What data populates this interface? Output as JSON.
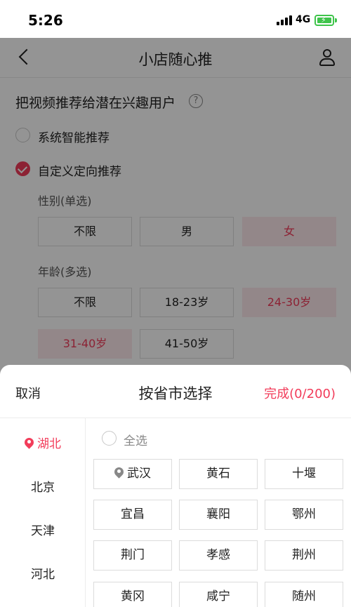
{
  "status_bar": {
    "time": "5:26",
    "network": "4G",
    "signal_icon": "signal-bars-icon",
    "battery_icon": "battery-charging-icon"
  },
  "nav": {
    "title": "小店随心推",
    "back_icon": "back-arrow-icon",
    "user_icon": "user-icon"
  },
  "main": {
    "section_title": "把视频推荐给潜在兴趣用户",
    "help_icon_glyph": "?",
    "options": [
      {
        "label": "系统智能推荐",
        "checked": false
      },
      {
        "label": "自定义定向推荐",
        "checked": true
      }
    ],
    "gender": {
      "label": "性别(单选)",
      "choices": [
        {
          "label": "不限",
          "selected": false
        },
        {
          "label": "男",
          "selected": false
        },
        {
          "label": "女",
          "selected": true
        }
      ]
    },
    "age": {
      "label": "年龄(多选)",
      "choices": [
        {
          "label": "不限",
          "selected": false
        },
        {
          "label": "18-23岁",
          "selected": false
        },
        {
          "label": "24-30岁",
          "selected": true
        },
        {
          "label": "31-40岁",
          "selected": true
        },
        {
          "label": "41-50岁",
          "selected": false
        }
      ]
    }
  },
  "sheet": {
    "cancel_label": "取消",
    "title": "按省市选择",
    "done_label": "完成(0/200)",
    "provinces": [
      {
        "label": "湖北",
        "active": true
      },
      {
        "label": "北京",
        "active": false
      },
      {
        "label": "天津",
        "active": false
      },
      {
        "label": "河北",
        "active": false
      }
    ],
    "select_all_label": "全选",
    "cities": [
      "武汉",
      "黄石",
      "十堰",
      "宜昌",
      "襄阳",
      "鄂州",
      "荆门",
      "孝感",
      "荆州",
      "黄冈",
      "咸宁",
      "随州"
    ]
  },
  "colors": {
    "accent": "#f23c5a",
    "selected_bg": "#fde8ec",
    "battery": "#3fc44b"
  }
}
